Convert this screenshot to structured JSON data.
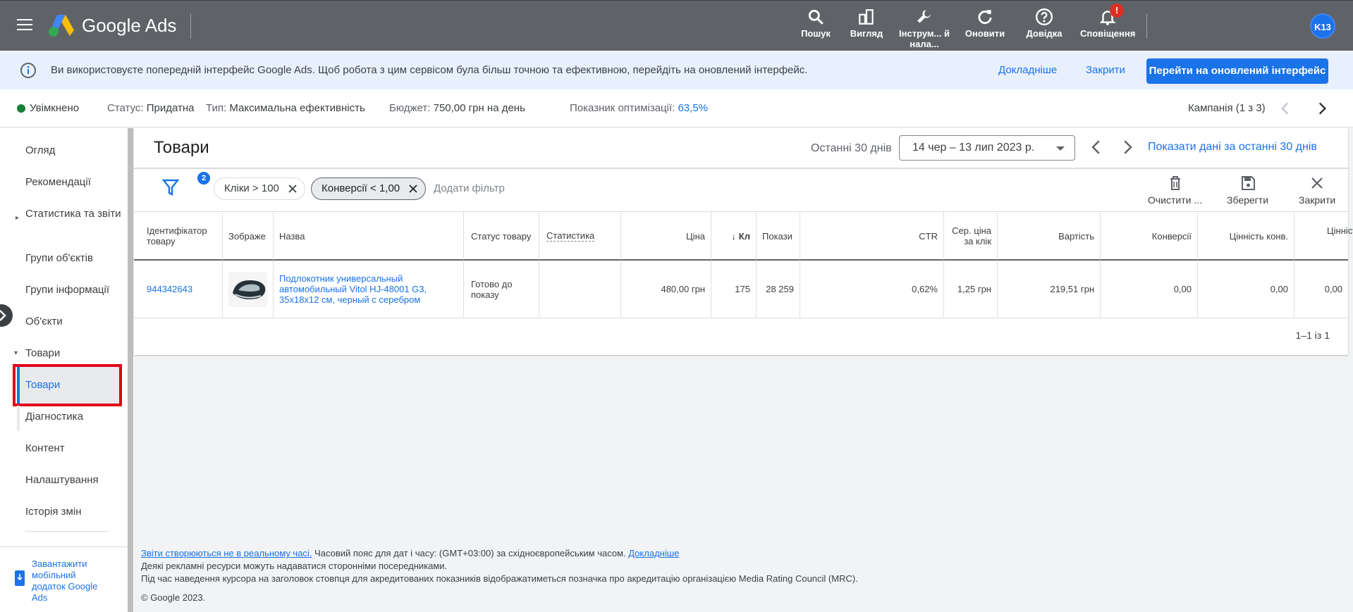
{
  "header": {
    "app_title": "Google Ads",
    "actions": [
      {
        "label": "Пошук",
        "icon": "search-icon"
      },
      {
        "label": "Вигляд",
        "icon": "view-icon"
      },
      {
        "label": "Інструм... й нала...",
        "icon": "wrench-icon"
      },
      {
        "label": "Оновити",
        "icon": "refresh-icon"
      },
      {
        "label": "Довідка",
        "icon": "help-icon"
      },
      {
        "label": "Сповіщення",
        "icon": "bell-icon",
        "badge": "!"
      }
    ],
    "avatar_initials": "K13"
  },
  "banner": {
    "text": "Ви використовуєте попередній інтерфейс Google Ads. Щоб робота з цим сервісом була більш точною та ефективною, перейдіть на оновлений інтерфейс.",
    "learn_more": "Докладніше",
    "close": "Закрити",
    "switch_button": "Перейти на оновлений інтерфейс"
  },
  "campaign": {
    "state": "Увімкнено",
    "status_label": "Статус:",
    "status_value": "Придатна",
    "type_label": "Тип:",
    "type_value": "Максимальна ефективність",
    "budget_label": "Бюджет:",
    "budget_value": "750,00 грн на день",
    "optimization_label": "Показник оптимізації:",
    "optimization_value": "63,5%",
    "pager": "Кампанія (1 з 3)"
  },
  "sidebar": {
    "items": [
      "Огляд",
      "Рекомендації",
      "Статистика та звіти",
      "Групи об'єктів",
      "Групи інформації",
      "Об'єкти",
      "Товари",
      "Товари",
      "Діагностика",
      "Контент",
      "Налаштування",
      "Історія змін"
    ],
    "mobile_app": "Завантажити мобільний додаток Google Ads"
  },
  "main": {
    "title": "Товари",
    "date_label": "Останні 30 днів",
    "date_range": "14 чер – 13 лип 2023 р.",
    "show_last_30": "Показати дані за останні 30 днів",
    "filter_count": "2",
    "filters": [
      "Кліки > 100",
      "Конверсії < 1,00"
    ],
    "add_filter": "Додати фільтр",
    "tools": {
      "clear": "Очистити ...",
      "save": "Зберегти",
      "close": "Закрити"
    }
  },
  "table": {
    "columns": [
      "Ідентифікатор товару",
      "Зображе",
      "Назва",
      "Статус товару",
      "Статистика",
      "Ціна",
      "Кл",
      "Покази",
      "CTR",
      "Сер. ціна за клік",
      "Вартість",
      "Конверсії",
      "Цінність конв.",
      "Цінність конв./ вартість"
    ],
    "rows": [
      {
        "id": "944342643",
        "name": "Подлокотник универсальный автомобильный Vitol HJ-48001 G3, 35x18x12 см, черный с серебром",
        "status": "Готово до показу",
        "statistics": "",
        "price": "480,00 грн",
        "clicks": "175",
        "impressions": "28 259",
        "ctr": "0,62%",
        "avg_cpc": "1,25 грн",
        "cost": "219,51 грн",
        "conversions": "0,00",
        "conv_value": "0,00",
        "conv_value_cost": "0,00"
      }
    ],
    "pager": "1–1 із 1"
  },
  "footer": {
    "reports_link": "Звіти створюються не в реальному часі.",
    "timezone_text": " Часовий пояс для дат і часу: (GMT+03:00) за східноєвропейським часом. ",
    "learn_more": "Докладніше",
    "line2": "Деякі рекламні ресурси можуть надаватися сторонніми посередниками.",
    "line3": "Під час наведення курсора на заголовок стовпця для акредитованих показників відображатиметься позначка про акредитацію організацією Media Rating Council (MRC).",
    "copyright": "© Google 2023."
  },
  "colors": {
    "topbar": "#5f6368",
    "accent": "#1a73e8",
    "banner_bg": "#e8f0fe",
    "status_green": "#188038",
    "highlight_red": "#e0001b"
  }
}
